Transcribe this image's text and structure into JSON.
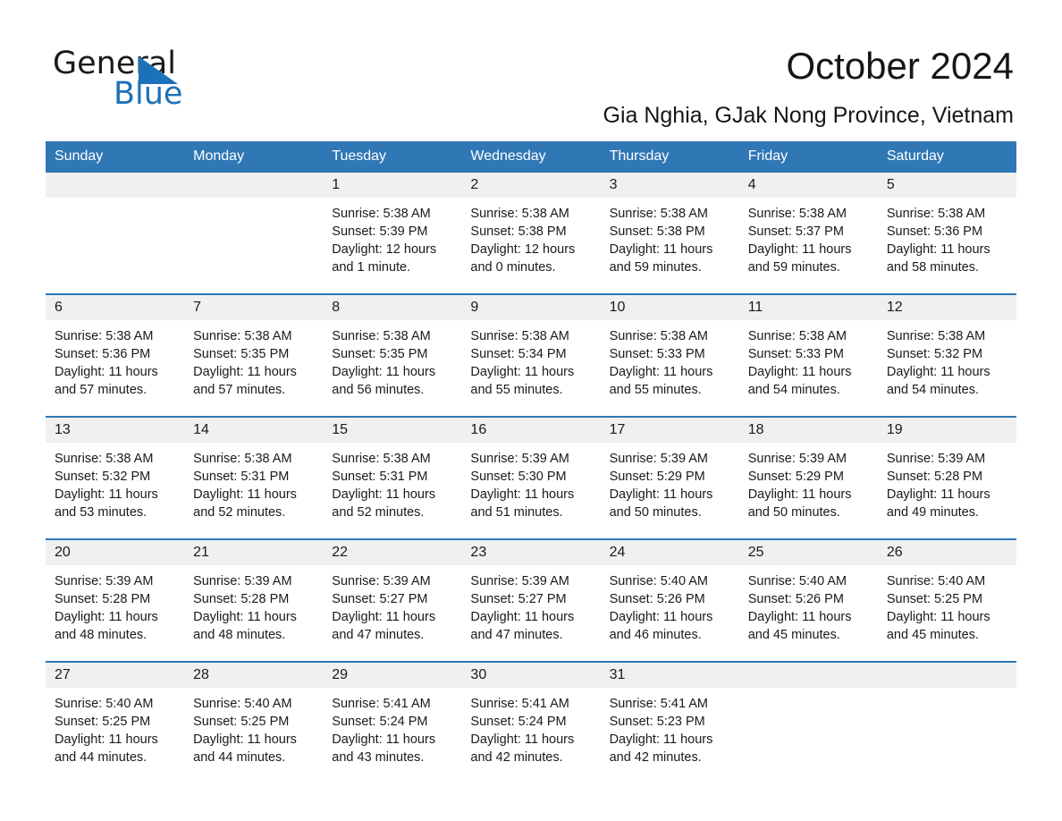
{
  "brand": {
    "line1": "General",
    "line2": "Blue",
    "triangle_color": "#1c72b8",
    "text_color": "#1a1a1a"
  },
  "header": {
    "title": "October 2024",
    "subtitle": "Gia Nghia, GJak Nong Province, Vietnam"
  },
  "colors": {
    "header_bar": "#2f77b5",
    "day_band": "#f0f0f0",
    "row_divider": "#2f77b5",
    "text": "#1a1a1a"
  },
  "weekday_headers": [
    "Sunday",
    "Monday",
    "Tuesday",
    "Wednesday",
    "Thursday",
    "Friday",
    "Saturday"
  ],
  "weeks": [
    [
      {
        "day": "",
        "sunrise": "",
        "sunset": "",
        "daylight_line1": "",
        "daylight_line2": ""
      },
      {
        "day": "",
        "sunrise": "",
        "sunset": "",
        "daylight_line1": "",
        "daylight_line2": ""
      },
      {
        "day": "1",
        "sunrise": "Sunrise: 5:38 AM",
        "sunset": "Sunset: 5:39 PM",
        "daylight_line1": "Daylight: 12 hours",
        "daylight_line2": "and 1 minute."
      },
      {
        "day": "2",
        "sunrise": "Sunrise: 5:38 AM",
        "sunset": "Sunset: 5:38 PM",
        "daylight_line1": "Daylight: 12 hours",
        "daylight_line2": "and 0 minutes."
      },
      {
        "day": "3",
        "sunrise": "Sunrise: 5:38 AM",
        "sunset": "Sunset: 5:38 PM",
        "daylight_line1": "Daylight: 11 hours",
        "daylight_line2": "and 59 minutes."
      },
      {
        "day": "4",
        "sunrise": "Sunrise: 5:38 AM",
        "sunset": "Sunset: 5:37 PM",
        "daylight_line1": "Daylight: 11 hours",
        "daylight_line2": "and 59 minutes."
      },
      {
        "day": "5",
        "sunrise": "Sunrise: 5:38 AM",
        "sunset": "Sunset: 5:36 PM",
        "daylight_line1": "Daylight: 11 hours",
        "daylight_line2": "and 58 minutes."
      }
    ],
    [
      {
        "day": "6",
        "sunrise": "Sunrise: 5:38 AM",
        "sunset": "Sunset: 5:36 PM",
        "daylight_line1": "Daylight: 11 hours",
        "daylight_line2": "and 57 minutes."
      },
      {
        "day": "7",
        "sunrise": "Sunrise: 5:38 AM",
        "sunset": "Sunset: 5:35 PM",
        "daylight_line1": "Daylight: 11 hours",
        "daylight_line2": "and 57 minutes."
      },
      {
        "day": "8",
        "sunrise": "Sunrise: 5:38 AM",
        "sunset": "Sunset: 5:35 PM",
        "daylight_line1": "Daylight: 11 hours",
        "daylight_line2": "and 56 minutes."
      },
      {
        "day": "9",
        "sunrise": "Sunrise: 5:38 AM",
        "sunset": "Sunset: 5:34 PM",
        "daylight_line1": "Daylight: 11 hours",
        "daylight_line2": "and 55 minutes."
      },
      {
        "day": "10",
        "sunrise": "Sunrise: 5:38 AM",
        "sunset": "Sunset: 5:33 PM",
        "daylight_line1": "Daylight: 11 hours",
        "daylight_line2": "and 55 minutes."
      },
      {
        "day": "11",
        "sunrise": "Sunrise: 5:38 AM",
        "sunset": "Sunset: 5:33 PM",
        "daylight_line1": "Daylight: 11 hours",
        "daylight_line2": "and 54 minutes."
      },
      {
        "day": "12",
        "sunrise": "Sunrise: 5:38 AM",
        "sunset": "Sunset: 5:32 PM",
        "daylight_line1": "Daylight: 11 hours",
        "daylight_line2": "and 54 minutes."
      }
    ],
    [
      {
        "day": "13",
        "sunrise": "Sunrise: 5:38 AM",
        "sunset": "Sunset: 5:32 PM",
        "daylight_line1": "Daylight: 11 hours",
        "daylight_line2": "and 53 minutes."
      },
      {
        "day": "14",
        "sunrise": "Sunrise: 5:38 AM",
        "sunset": "Sunset: 5:31 PM",
        "daylight_line1": "Daylight: 11 hours",
        "daylight_line2": "and 52 minutes."
      },
      {
        "day": "15",
        "sunrise": "Sunrise: 5:38 AM",
        "sunset": "Sunset: 5:31 PM",
        "daylight_line1": "Daylight: 11 hours",
        "daylight_line2": "and 52 minutes."
      },
      {
        "day": "16",
        "sunrise": "Sunrise: 5:39 AM",
        "sunset": "Sunset: 5:30 PM",
        "daylight_line1": "Daylight: 11 hours",
        "daylight_line2": "and 51 minutes."
      },
      {
        "day": "17",
        "sunrise": "Sunrise: 5:39 AM",
        "sunset": "Sunset: 5:29 PM",
        "daylight_line1": "Daylight: 11 hours",
        "daylight_line2": "and 50 minutes."
      },
      {
        "day": "18",
        "sunrise": "Sunrise: 5:39 AM",
        "sunset": "Sunset: 5:29 PM",
        "daylight_line1": "Daylight: 11 hours",
        "daylight_line2": "and 50 minutes."
      },
      {
        "day": "19",
        "sunrise": "Sunrise: 5:39 AM",
        "sunset": "Sunset: 5:28 PM",
        "daylight_line1": "Daylight: 11 hours",
        "daylight_line2": "and 49 minutes."
      }
    ],
    [
      {
        "day": "20",
        "sunrise": "Sunrise: 5:39 AM",
        "sunset": "Sunset: 5:28 PM",
        "daylight_line1": "Daylight: 11 hours",
        "daylight_line2": "and 48 minutes."
      },
      {
        "day": "21",
        "sunrise": "Sunrise: 5:39 AM",
        "sunset": "Sunset: 5:28 PM",
        "daylight_line1": "Daylight: 11 hours",
        "daylight_line2": "and 48 minutes."
      },
      {
        "day": "22",
        "sunrise": "Sunrise: 5:39 AM",
        "sunset": "Sunset: 5:27 PM",
        "daylight_line1": "Daylight: 11 hours",
        "daylight_line2": "and 47 minutes."
      },
      {
        "day": "23",
        "sunrise": "Sunrise: 5:39 AM",
        "sunset": "Sunset: 5:27 PM",
        "daylight_line1": "Daylight: 11 hours",
        "daylight_line2": "and 47 minutes."
      },
      {
        "day": "24",
        "sunrise": "Sunrise: 5:40 AM",
        "sunset": "Sunset: 5:26 PM",
        "daylight_line1": "Daylight: 11 hours",
        "daylight_line2": "and 46 minutes."
      },
      {
        "day": "25",
        "sunrise": "Sunrise: 5:40 AM",
        "sunset": "Sunset: 5:26 PM",
        "daylight_line1": "Daylight: 11 hours",
        "daylight_line2": "and 45 minutes."
      },
      {
        "day": "26",
        "sunrise": "Sunrise: 5:40 AM",
        "sunset": "Sunset: 5:25 PM",
        "daylight_line1": "Daylight: 11 hours",
        "daylight_line2": "and 45 minutes."
      }
    ],
    [
      {
        "day": "27",
        "sunrise": "Sunrise: 5:40 AM",
        "sunset": "Sunset: 5:25 PM",
        "daylight_line1": "Daylight: 11 hours",
        "daylight_line2": "and 44 minutes."
      },
      {
        "day": "28",
        "sunrise": "Sunrise: 5:40 AM",
        "sunset": "Sunset: 5:25 PM",
        "daylight_line1": "Daylight: 11 hours",
        "daylight_line2": "and 44 minutes."
      },
      {
        "day": "29",
        "sunrise": "Sunrise: 5:41 AM",
        "sunset": "Sunset: 5:24 PM",
        "daylight_line1": "Daylight: 11 hours",
        "daylight_line2": "and 43 minutes."
      },
      {
        "day": "30",
        "sunrise": "Sunrise: 5:41 AM",
        "sunset": "Sunset: 5:24 PM",
        "daylight_line1": "Daylight: 11 hours",
        "daylight_line2": "and 42 minutes."
      },
      {
        "day": "31",
        "sunrise": "Sunrise: 5:41 AM",
        "sunset": "Sunset: 5:23 PM",
        "daylight_line1": "Daylight: 11 hours",
        "daylight_line2": "and 42 minutes."
      },
      {
        "day": "",
        "sunrise": "",
        "sunset": "",
        "daylight_line1": "",
        "daylight_line2": ""
      },
      {
        "day": "",
        "sunrise": "",
        "sunset": "",
        "daylight_line1": "",
        "daylight_line2": ""
      }
    ]
  ]
}
